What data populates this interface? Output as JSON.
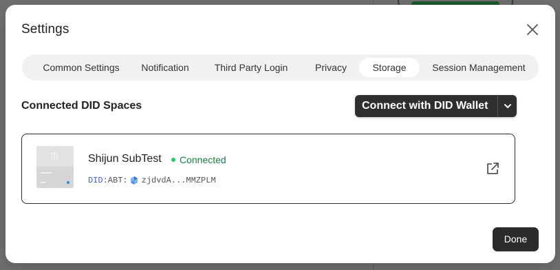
{
  "dialog": {
    "title": "Settings",
    "close_icon": "close-icon"
  },
  "tabs": [
    {
      "label": "Common Settings",
      "active": false
    },
    {
      "label": "Notification",
      "active": false
    },
    {
      "label": "Third Party Login",
      "active": false
    },
    {
      "label": "Privacy",
      "active": false
    },
    {
      "label": "Storage",
      "active": true
    },
    {
      "label": "Session Management",
      "active": false
    }
  ],
  "storage": {
    "section_title": "Connected DID Spaces",
    "connect_button_label": "Connect with DID Wallet",
    "connect_dropdown_icon": "chevron-down-icon",
    "space": {
      "name": "Shijun SubTest",
      "status": "Connected",
      "did_prefix": "DID",
      "did_type": ":ABT:",
      "did_short": "zjdvdA...MMZPLM",
      "open_icon": "external-link-icon"
    }
  },
  "footer": {
    "done_label": "Done"
  },
  "colors": {
    "accent_dark": "#2f2f2f",
    "status_green": "#28c76f",
    "did_blue": "#3b5bd6"
  }
}
